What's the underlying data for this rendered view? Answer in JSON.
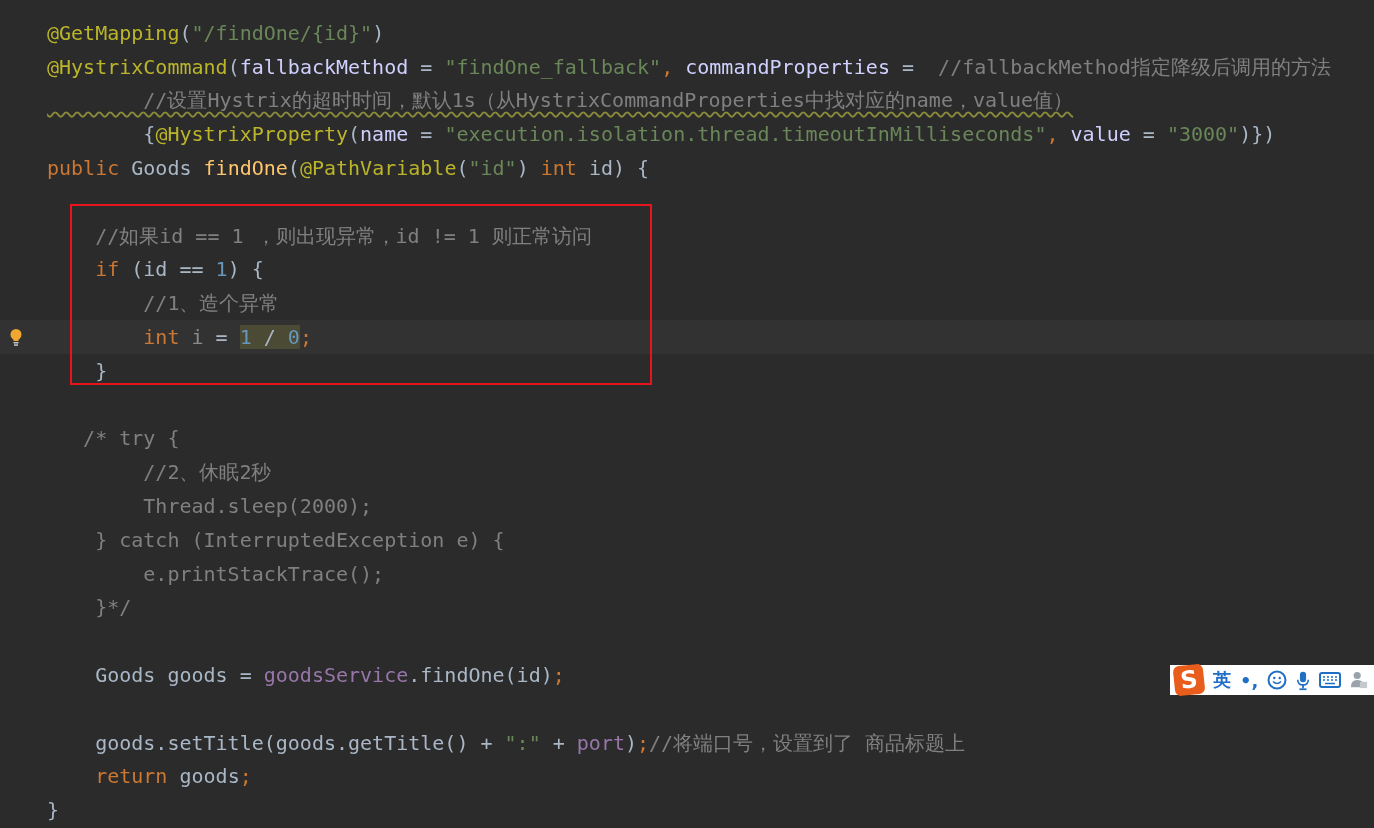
{
  "editor": {
    "lines": [
      {
        "current": false,
        "tokens": [
          {
            "text": "@GetMapping",
            "kind": "annotation"
          },
          {
            "text": "(",
            "kind": "plain"
          },
          {
            "text": "\"/findOne/{id}\"",
            "kind": "string"
          },
          {
            "text": ")",
            "kind": "plain"
          }
        ]
      },
      {
        "current": false,
        "tokens": [
          {
            "text": "@HystrixCommand",
            "kind": "annotation"
          },
          {
            "text": "(",
            "kind": "plain"
          },
          {
            "text": "fallbackMethod",
            "kind": "param"
          },
          {
            "text": " = ",
            "kind": "plain"
          },
          {
            "text": "\"findOne_fallback\"",
            "kind": "string"
          },
          {
            "text": ", ",
            "kind": "keyword"
          },
          {
            "text": "commandProperties",
            "kind": "param"
          },
          {
            "text": " =  ",
            "kind": "plain"
          },
          {
            "text": "//fallbackMethod指定降级后调用的方法",
            "kind": "comment"
          }
        ]
      },
      {
        "current": false,
        "tokens": [
          {
            "text": "        //设置Hystrix的超时时间，默认1s（从HystrixCommandProperties中找对应的name，value值）",
            "kind": "typo"
          }
        ]
      },
      {
        "current": false,
        "tokens": [
          {
            "text": "        {",
            "kind": "plain"
          },
          {
            "text": "@HystrixProperty",
            "kind": "annotation"
          },
          {
            "text": "(",
            "kind": "plain"
          },
          {
            "text": "name",
            "kind": "param"
          },
          {
            "text": " = ",
            "kind": "plain"
          },
          {
            "text": "\"execution.isolation.thread.timeoutInMilliseconds\"",
            "kind": "string"
          },
          {
            "text": ", ",
            "kind": "keyword"
          },
          {
            "text": "value",
            "kind": "param"
          },
          {
            "text": " = ",
            "kind": "plain"
          },
          {
            "text": "\"3000\"",
            "kind": "string"
          },
          {
            "text": ")})",
            "kind": "plain"
          }
        ]
      },
      {
        "current": false,
        "tokens": [
          {
            "text": "public",
            "kind": "keyword"
          },
          {
            "text": " Goods ",
            "kind": "plain"
          },
          {
            "text": "findOne",
            "kind": "method"
          },
          {
            "text": "(",
            "kind": "plain"
          },
          {
            "text": "@PathVariable",
            "kind": "annotation"
          },
          {
            "text": "(",
            "kind": "plain"
          },
          {
            "text": "\"id\"",
            "kind": "string"
          },
          {
            "text": ") ",
            "kind": "plain"
          },
          {
            "text": "int",
            "kind": "keyword"
          },
          {
            "text": " id) {",
            "kind": "plain"
          }
        ]
      },
      {
        "current": false
      },
      {
        "current": false,
        "tokens": [
          {
            "text": "    //如果id == 1 ，则出现异常，id != 1 则正常访问",
            "kind": "comment"
          }
        ]
      },
      {
        "current": false,
        "tokens": [
          {
            "text": "    if",
            "kind": "keyword"
          },
          {
            "text": " (id == ",
            "kind": "plain"
          },
          {
            "text": "1",
            "kind": "number"
          },
          {
            "text": ") {",
            "kind": "plain"
          }
        ]
      },
      {
        "current": false,
        "tokens": [
          {
            "text": "        //1、造个异常",
            "kind": "comment"
          }
        ]
      },
      {
        "current": true,
        "tokens": [
          {
            "text": "        int ",
            "kind": "keyword"
          },
          {
            "text": "i",
            "kind": "unused"
          },
          {
            "text": " = ",
            "kind": "plain"
          },
          {
            "text": "1",
            "kind": "number-match"
          },
          {
            "text": " / ",
            "kind": "plain-match"
          },
          {
            "text": "0",
            "kind": "number-match"
          },
          {
            "text": ";",
            "kind": "keyword"
          }
        ]
      },
      {
        "current": false,
        "tokens": [
          {
            "text": "    }",
            "kind": "plain"
          }
        ]
      },
      {
        "current": false
      },
      {
        "current": false,
        "tokens": [
          {
            "text": "   /* try {",
            "kind": "comment"
          }
        ]
      },
      {
        "current": false,
        "tokens": [
          {
            "text": "        //2、休眠2秒",
            "kind": "comment"
          }
        ]
      },
      {
        "current": false,
        "tokens": [
          {
            "text": "        Thread.sleep(2000);",
            "kind": "comment"
          }
        ]
      },
      {
        "current": false,
        "tokens": [
          {
            "text": "    } catch (InterruptedException e) {",
            "kind": "comment"
          }
        ]
      },
      {
        "current": false,
        "tokens": [
          {
            "text": "        e.printStackTrace();",
            "kind": "comment"
          }
        ]
      },
      {
        "current": false,
        "tokens": [
          {
            "text": "    }*/",
            "kind": "comment"
          }
        ]
      },
      {
        "current": false
      },
      {
        "current": false,
        "tokens": [
          {
            "text": "    Goods goods = ",
            "kind": "plain"
          },
          {
            "text": "goodsService",
            "kind": "field"
          },
          {
            "text": ".findOne(id)",
            "kind": "plain"
          },
          {
            "text": ";",
            "kind": "keyword"
          }
        ]
      },
      {
        "current": false
      },
      {
        "current": false,
        "tokens": [
          {
            "text": "    goods.setTitle(goods.getTitle() + ",
            "kind": "plain"
          },
          {
            "text": "\":\"",
            "kind": "string"
          },
          {
            "text": " + ",
            "kind": "plain"
          },
          {
            "text": "port",
            "kind": "field"
          },
          {
            "text": ")",
            "kind": "plain"
          },
          {
            "text": ";",
            "kind": "keyword"
          },
          {
            "text": "//将端口号，设置到了 商品标题上",
            "kind": "comment"
          }
        ]
      },
      {
        "current": false,
        "tokens": [
          {
            "text": "    return",
            "kind": "keyword"
          },
          {
            "text": " goods",
            "kind": "plain"
          },
          {
            "text": ";",
            "kind": "keyword"
          }
        ]
      },
      {
        "current": false,
        "tokens": [
          {
            "text": "}",
            "kind": "plain"
          }
        ]
      }
    ]
  },
  "ime_toolbar": {
    "logo": "S",
    "mode": "英",
    "punctuation": "•,"
  }
}
